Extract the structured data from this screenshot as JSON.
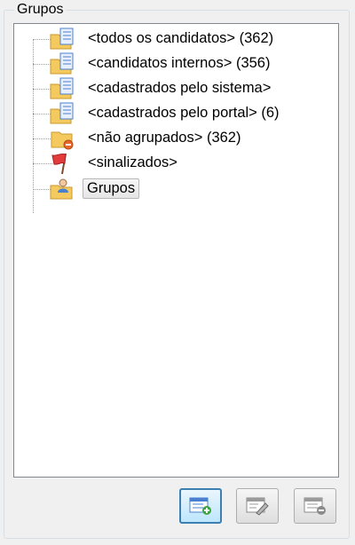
{
  "panel": {
    "title": "Grupos"
  },
  "tree": {
    "items": [
      {
        "label": "<todos os candidatos> (362)",
        "icon": "folder-list-icon"
      },
      {
        "label": "<candidatos internos> (356)",
        "icon": "folder-list-icon"
      },
      {
        "label": "<cadastrados pelo sistema>",
        "icon": "folder-list-icon"
      },
      {
        "label": "<cadastrados pelo portal> (6)",
        "icon": "folder-list-icon"
      },
      {
        "label": "<não agrupados> (362)",
        "icon": "folder-minus-icon"
      },
      {
        "label": "<sinalizados>",
        "icon": "red-flag-icon"
      },
      {
        "label": "Grupos",
        "icon": "folder-user-icon"
      }
    ]
  },
  "toolbar": {
    "buttons": [
      {
        "name": "add-group-button",
        "icon": "list-add-icon"
      },
      {
        "name": "edit-group-button",
        "icon": "list-edit-icon"
      },
      {
        "name": "remove-group-button",
        "icon": "list-remove-icon"
      }
    ]
  },
  "colors": {
    "accent": "#3c7fb1",
    "folder": "#f4c95d",
    "list": "#4a7fd0",
    "flag": "#e23b3b"
  }
}
